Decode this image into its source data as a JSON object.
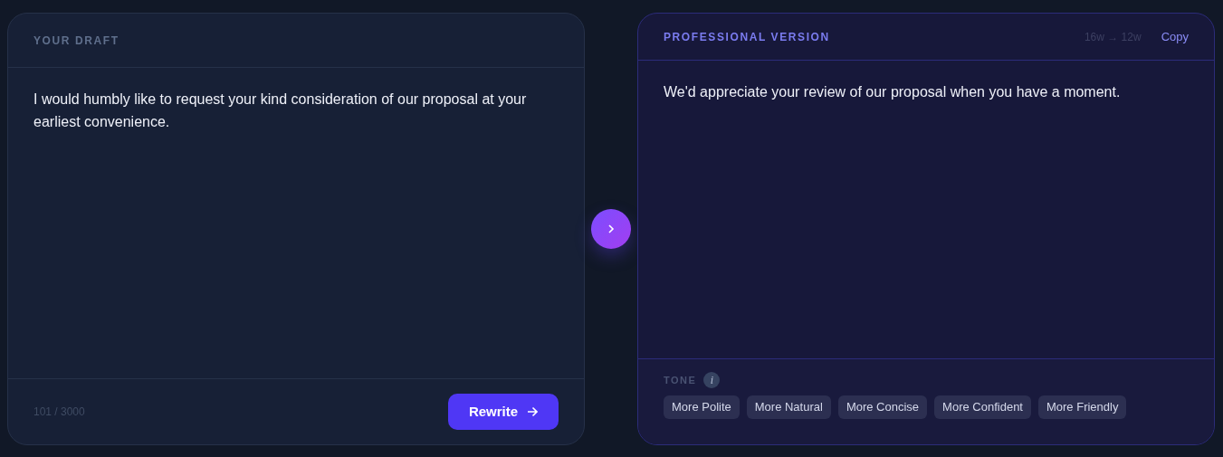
{
  "draft": {
    "title": "YOUR DRAFT",
    "text": "I would humbly like to request your kind consideration of our proposal at your earliest convenience.",
    "count": "101 / 3000",
    "button": "Rewrite"
  },
  "result": {
    "title": "PROFESSIONAL VERSION",
    "word_count": "16w → 12w",
    "copy": "Copy",
    "text": "We'd appreciate your review of our proposal when you have a moment.",
    "tone_label": "TONE",
    "tone_info": "i",
    "tones": [
      {
        "label": "More Polite"
      },
      {
        "label": "More Natural"
      },
      {
        "label": "More Concise"
      },
      {
        "label": "More Confident"
      },
      {
        "label": "More Friendly"
      }
    ]
  }
}
